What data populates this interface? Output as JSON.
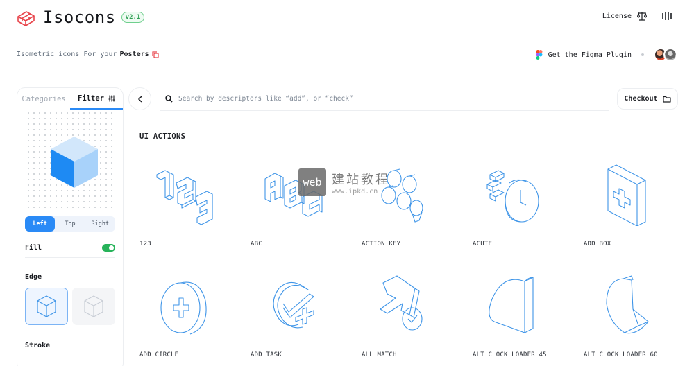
{
  "app": {
    "title": "Isocons",
    "version": "v2.1",
    "tagline_prefix": "Isometric icons For your",
    "tagline_highlight": "Posters"
  },
  "header": {
    "license_label": "License",
    "figma_label": "Get the Figma Plugin"
  },
  "sidebar": {
    "tabs": [
      {
        "label": "Categories",
        "active": false
      },
      {
        "label": "Filter",
        "active": true
      }
    ],
    "view_options": [
      {
        "label": "Left",
        "active": true
      },
      {
        "label": "Top",
        "active": false
      },
      {
        "label": "Right",
        "active": false
      }
    ],
    "fill_label": "Fill",
    "fill_on": true,
    "edge_label": "Edge",
    "stroke_label": "Stroke"
  },
  "search": {
    "placeholder": "Search by descriptors like “add”, or “check”"
  },
  "checkout_label": "Checkout",
  "section": {
    "title": "UI ACTIONS",
    "icons": [
      {
        "label": "123",
        "icon": "numbers-123-icon"
      },
      {
        "label": "ABC",
        "icon": "letters-abc-icon"
      },
      {
        "label": "ACTION KEY",
        "icon": "action-key-icon"
      },
      {
        "label": "ACUTE",
        "icon": "acute-clock-icon"
      },
      {
        "label": "ADD BOX",
        "icon": "add-box-icon"
      },
      {
        "label": "ADD CIRCLE",
        "icon": "add-circle-icon"
      },
      {
        "label": "ADD TASK",
        "icon": "add-task-icon"
      },
      {
        "label": "ALL MATCH",
        "icon": "all-match-icon"
      },
      {
        "label": "ALT CLOCK LOADER 45",
        "icon": "clock-loader-45-icon"
      },
      {
        "label": "ALT CLOCK LOADER 60",
        "icon": "clock-loader-60-icon"
      }
    ]
  },
  "watermark": {
    "box": "web",
    "chinese": "建站教程",
    "url": "www.ipkd.cn"
  },
  "colors": {
    "accent": "#2a8af6",
    "logo": "#e8434a",
    "icon_stroke": "#3f95e8",
    "toggle_on": "#27b35a"
  }
}
